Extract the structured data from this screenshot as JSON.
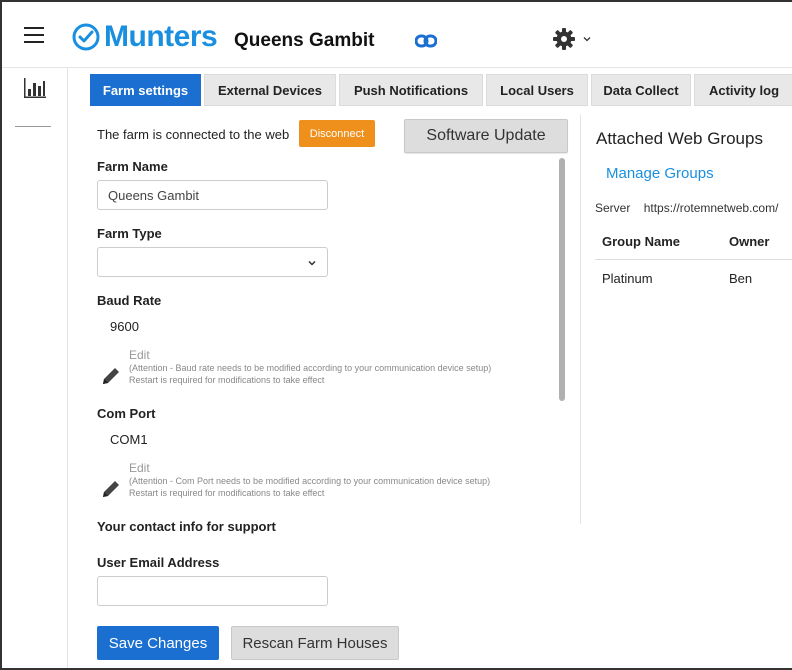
{
  "header": {
    "brand": "Munters",
    "farm_title": "Queens Gambit",
    "colors": {
      "brand": "#1a8fe0",
      "accent": "#1a6fd0",
      "warning": "#f0901c"
    }
  },
  "tabs": [
    {
      "label": "Farm settings",
      "active": true
    },
    {
      "label": "External Devices",
      "active": false
    },
    {
      "label": "Push Notifications",
      "active": false
    },
    {
      "label": "Local Users",
      "active": false
    },
    {
      "label": "Data Collect",
      "active": false
    },
    {
      "label": "Activity log",
      "active": false
    }
  ],
  "connection": {
    "status_text": "The farm is connected to the web",
    "disconnect_label": "Disconnect",
    "software_update_label": "Software Update"
  },
  "farm_name": {
    "label": "Farm Name",
    "value": "Queens Gambit"
  },
  "farm_type": {
    "label": "Farm Type",
    "value": ""
  },
  "baud_rate": {
    "label": "Baud Rate",
    "value": "9600",
    "edit_label": "Edit",
    "note_line1": "(Attention - Baud rate needs to be modified according to your communication device setup)",
    "note_line2": "Restart is required for modifications to take effect"
  },
  "com_port": {
    "label": "Com Port",
    "value": "COM1",
    "edit_label": "Edit",
    "note_line1": "(Attention - Com Port needs to be modified according to your communication device setup)",
    "note_line2": "Restart is required for modifications to take effect"
  },
  "support": {
    "heading": "Your contact info for support"
  },
  "user_email": {
    "label": "User Email Address",
    "value": ""
  },
  "right_panel": {
    "title": "Attached Web Groups",
    "manage_groups_label": "Manage Groups",
    "server_label": "Server",
    "server_value": "https://rotemnetweb.com/",
    "columns": [
      "Group Name",
      "Owner"
    ],
    "rows": [
      {
        "group_name": "Platinum",
        "owner": "Ben"
      }
    ]
  },
  "footer": {
    "save_label": "Save Changes",
    "rescan_label": "Rescan Farm Houses"
  }
}
